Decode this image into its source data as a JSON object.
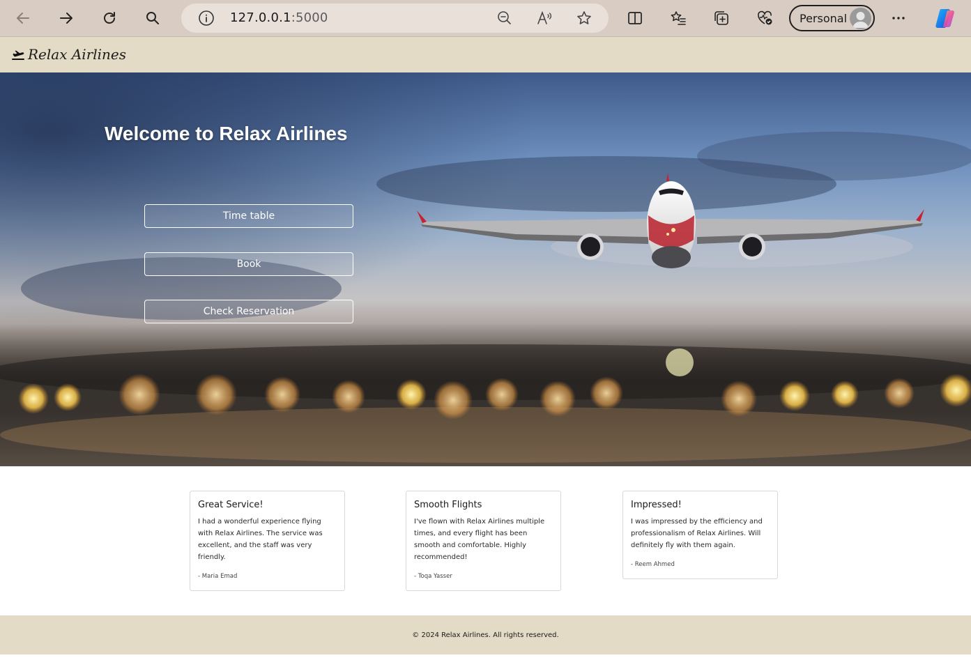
{
  "browser": {
    "url_host": "127.0.0.1",
    "url_port": ":5000",
    "profile_label": "Personal",
    "icons": [
      "back-icon",
      "forward-icon",
      "refresh-icon",
      "search-icon",
      "info-icon",
      "zoom-out-icon",
      "read-aloud-icon",
      "favorite-star-icon",
      "split-screen-icon",
      "favorites-icon",
      "collections-icon",
      "browser-essentials-icon",
      "more-icon",
      "copilot-icon"
    ]
  },
  "site": {
    "brand": "Relax Airlines",
    "brand_icon": "plane-departure-icon"
  },
  "hero": {
    "title": "Welcome to Relax Airlines",
    "buttons": {
      "timetable": "Time table",
      "book": "Book",
      "check": "Check Reservation"
    }
  },
  "testimonials": [
    {
      "title": "Great Service!",
      "text": "I had a wonderful experience flying with Relax Airlines. The service was excellent, and the staff was very friendly.",
      "author": "- Maria Emad"
    },
    {
      "title": "Smooth Flights",
      "text": "I've flown with Relax Airlines multiple times, and every flight has been smooth and comfortable. Highly recommended!",
      "author": "- Toqa Yasser"
    },
    {
      "title": "Impressed!",
      "text": "I was impressed by the efficiency and professionalism of Relax Airlines. Will definitely fly with them again.",
      "author": "- Reem Ahmed"
    }
  ],
  "footer": {
    "text": "© 2024 Relax Airlines. All rights reserved."
  },
  "colors": {
    "browser_chrome": "#d9ccc3",
    "site_nav": "#e3dbc5",
    "footer": "#e3dbc5",
    "hero_button_border": "#ffffff"
  }
}
